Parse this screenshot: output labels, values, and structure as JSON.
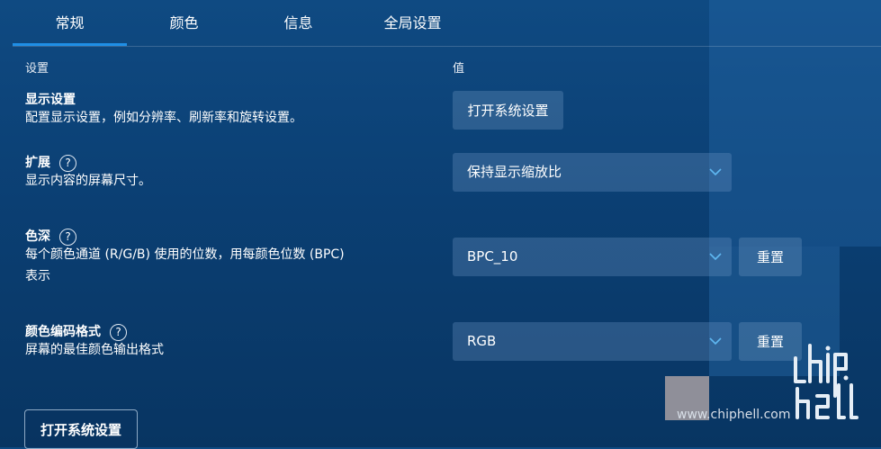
{
  "tabs": [
    {
      "label": "常规",
      "active": true
    },
    {
      "label": "颜色",
      "active": false
    },
    {
      "label": "信息",
      "active": false
    },
    {
      "label": "全局设置",
      "active": false
    }
  ],
  "columns": {
    "setting": "设置",
    "value": "值"
  },
  "display": {
    "title": "显示设置",
    "desc": "配置显示设置，例如分辨率、刷新率和旋转设置。",
    "button": "打开系统设置"
  },
  "scaling": {
    "title": "扩展",
    "desc": "显示内容的屏幕尺寸。",
    "value": "保持显示缩放比"
  },
  "color_depth": {
    "title": "色深",
    "desc_line1": "每个颜色通道 (R/G/B) 使用的位数，用每颜色位数 (BPC)",
    "desc_line2": "表示",
    "value": "BPC_10",
    "reset": "重置"
  },
  "color_format": {
    "title": "颜色编码格式",
    "desc": "屏幕的最佳颜色输出格式",
    "value": "RGB",
    "reset": "重置"
  },
  "help_glyph": "?",
  "bottom_button": "打开系统设置",
  "watermark": {
    "url": "www.chiphell.com"
  },
  "colors": {
    "accent": "#1f8fe6",
    "background": "#0b3f73"
  }
}
